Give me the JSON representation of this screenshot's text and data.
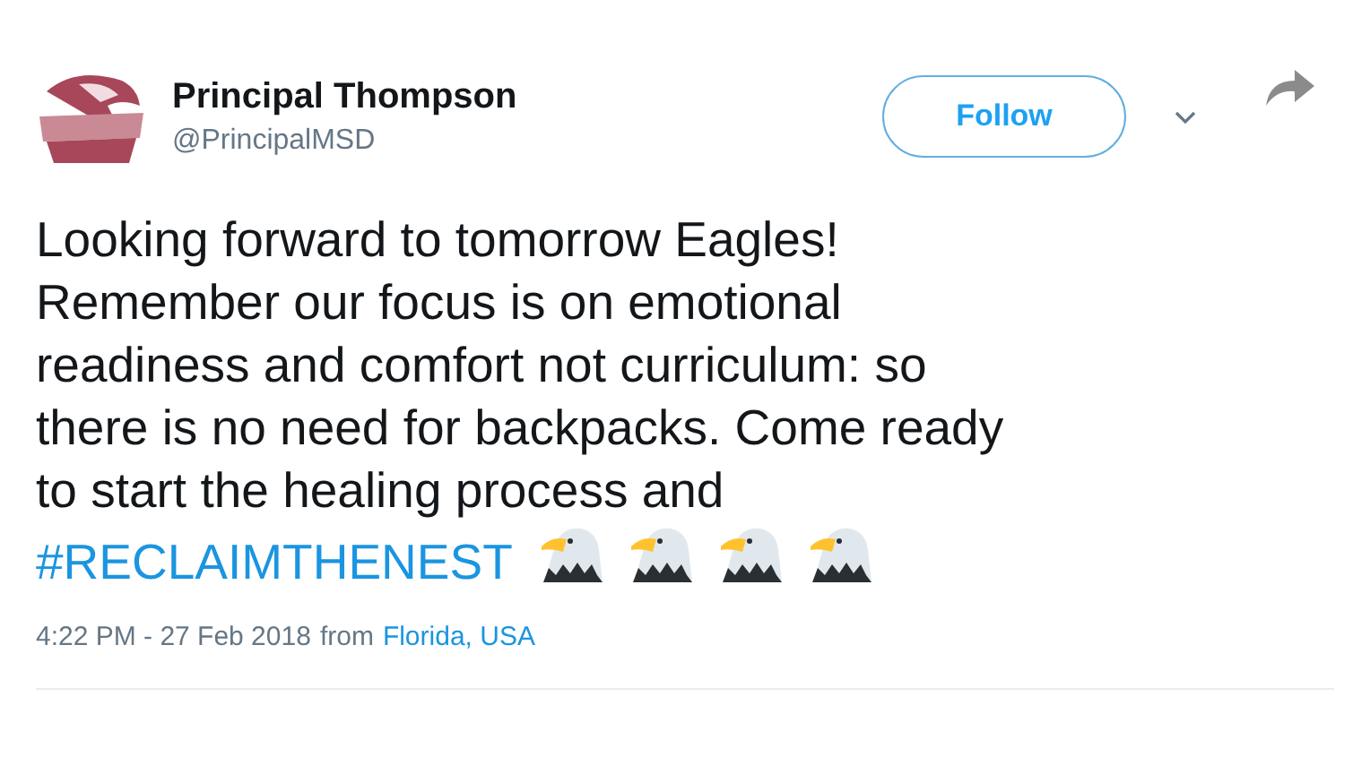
{
  "author": {
    "name": "Principal Thompson",
    "handle": "@PrincipalMSD"
  },
  "follow_button": {
    "label": "Follow"
  },
  "tweet": {
    "lines": [
      "Looking forward to tomorrow Eagles!",
      "Remember our focus is on emotional",
      "readiness and comfort not curriculum: so",
      "there is no need for backpacks. Come ready",
      "to start the healing process and"
    ],
    "hashtag": "#RECLAIMTHENEST",
    "emoji": [
      {
        "kind": "eagle"
      },
      {
        "kind": "eagle"
      },
      {
        "kind": "eagle"
      },
      {
        "kind": "eagle"
      }
    ]
  },
  "meta": {
    "time": "4:22 PM - 27 Feb 2018",
    "from": "from",
    "location": "Florida, USA"
  }
}
